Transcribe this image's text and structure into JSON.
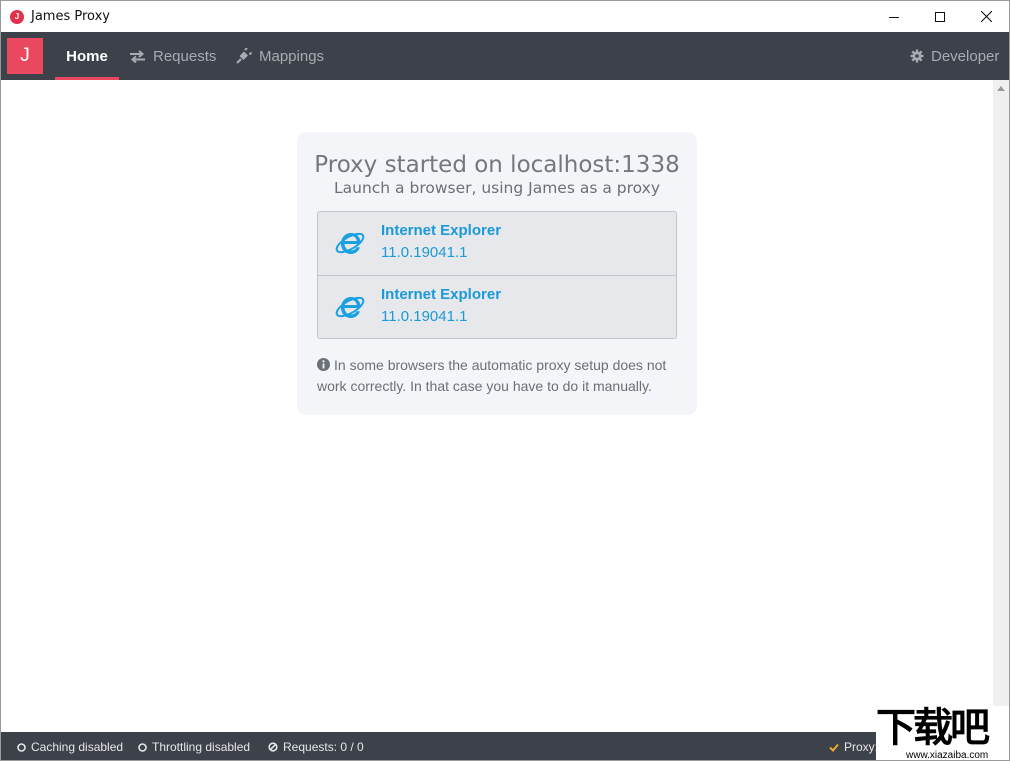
{
  "window": {
    "title": "James Proxy",
    "app_icon_letter": "J"
  },
  "nav": {
    "brand_letter": "J",
    "items": [
      {
        "label": "Home",
        "icon": "home",
        "active": true
      },
      {
        "label": "Requests",
        "icon": "exchange-arrows-icon",
        "active": false
      },
      {
        "label": "Mappings",
        "icon": "plug-icon",
        "active": false
      }
    ],
    "developer_label": "Developer"
  },
  "main": {
    "title": "Proxy started on localhost:1338",
    "subtitle": "Launch a browser, using James as a proxy",
    "browsers": [
      {
        "name": "Internet Explorer",
        "version": "11.0.19041.1",
        "icon": "internet-explorer-icon"
      },
      {
        "name": "Internet Explorer",
        "version": "11.0.19041.1",
        "icon": "internet-explorer-icon"
      }
    ],
    "note": "In some browsers the automatic proxy setup does not work correctly. In that case you have to do it manually."
  },
  "status": {
    "caching": "Caching disabled",
    "throttling": "Throttling disabled",
    "requests": "Requests: 0 / 0",
    "proxy": "Proxy:"
  },
  "watermark": {
    "text": "下载吧",
    "url": "www.xiazaiba.com"
  },
  "colors": {
    "accent": "#e9485f",
    "nav_bg": "#3d4149",
    "link": "#1a9ad6",
    "card_bg": "#f4f5f8"
  }
}
